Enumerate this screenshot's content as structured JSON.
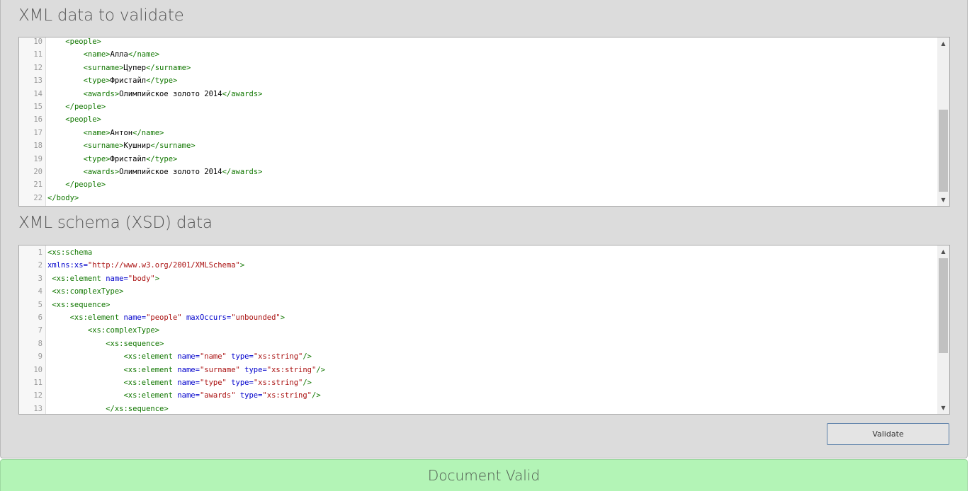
{
  "xml_section": {
    "title": "XML data to validate",
    "lines": [
      {
        "n": "10",
        "indent": "    ",
        "parts": [
          [
            "t",
            "<people>"
          ]
        ]
      },
      {
        "n": "11",
        "indent": "        ",
        "parts": [
          [
            "t",
            "<name>"
          ],
          [
            "x",
            "Алла"
          ],
          [
            "t",
            "</name>"
          ]
        ]
      },
      {
        "n": "12",
        "indent": "        ",
        "parts": [
          [
            "t",
            "<surname>"
          ],
          [
            "x",
            "Цупер"
          ],
          [
            "t",
            "</surname>"
          ]
        ]
      },
      {
        "n": "13",
        "indent": "        ",
        "parts": [
          [
            "t",
            "<type>"
          ],
          [
            "x",
            "Фристайл"
          ],
          [
            "t",
            "</type>"
          ]
        ]
      },
      {
        "n": "14",
        "indent": "        ",
        "parts": [
          [
            "t",
            "<awards>"
          ],
          [
            "x",
            "Олимпийское золото 2014"
          ],
          [
            "t",
            "</awards>"
          ]
        ]
      },
      {
        "n": "15",
        "indent": "    ",
        "parts": [
          [
            "t",
            "</people>"
          ]
        ]
      },
      {
        "n": "16",
        "indent": "    ",
        "parts": [
          [
            "t",
            "<people>"
          ]
        ]
      },
      {
        "n": "17",
        "indent": "        ",
        "parts": [
          [
            "t",
            "<name>"
          ],
          [
            "x",
            "Антон"
          ],
          [
            "t",
            "</name>"
          ]
        ]
      },
      {
        "n": "18",
        "indent": "        ",
        "parts": [
          [
            "t",
            "<surname>"
          ],
          [
            "x",
            "Кушнир"
          ],
          [
            "t",
            "</surname>"
          ]
        ]
      },
      {
        "n": "19",
        "indent": "        ",
        "parts": [
          [
            "t",
            "<type>"
          ],
          [
            "x",
            "Фристайл"
          ],
          [
            "t",
            "</type>"
          ]
        ]
      },
      {
        "n": "20",
        "indent": "        ",
        "parts": [
          [
            "t",
            "<awards>"
          ],
          [
            "x",
            "Олимпийское золото 2014"
          ],
          [
            "t",
            "</awards>"
          ]
        ]
      },
      {
        "n": "21",
        "indent": "    ",
        "parts": [
          [
            "t",
            "</people>"
          ]
        ]
      },
      {
        "n": "22",
        "indent": "",
        "parts": [
          [
            "t",
            "</body>"
          ]
        ]
      }
    ]
  },
  "xsd_section": {
    "title": "XML schema (XSD) data",
    "lines": [
      {
        "n": "1",
        "indent": "",
        "parts": [
          [
            "t",
            "<xs:schema"
          ]
        ]
      },
      {
        "n": "2",
        "indent": "",
        "parts": [
          [
            "a",
            "xmlns:xs="
          ],
          [
            "s",
            "\"http://www.w3.org/2001/XMLSchema\""
          ],
          [
            "t",
            ">"
          ]
        ]
      },
      {
        "n": "3",
        "indent": " ",
        "parts": [
          [
            "t",
            "<xs:element "
          ],
          [
            "a",
            "name="
          ],
          [
            "s",
            "\"body\""
          ],
          [
            "t",
            ">"
          ]
        ]
      },
      {
        "n": "4",
        "indent": " ",
        "parts": [
          [
            "t",
            "<xs:complexType>"
          ]
        ]
      },
      {
        "n": "5",
        "indent": " ",
        "parts": [
          [
            "t",
            "<xs:sequence>"
          ]
        ]
      },
      {
        "n": "6",
        "indent": "     ",
        "parts": [
          [
            "t",
            "<xs:element "
          ],
          [
            "a",
            "name="
          ],
          [
            "s",
            "\"people\""
          ],
          [
            "a",
            " maxOccurs="
          ],
          [
            "s",
            "\"unbounded\""
          ],
          [
            "t",
            ">"
          ]
        ]
      },
      {
        "n": "7",
        "indent": "         ",
        "parts": [
          [
            "t",
            "<xs:complexType>"
          ]
        ]
      },
      {
        "n": "8",
        "indent": "             ",
        "parts": [
          [
            "t",
            "<xs:sequence>"
          ]
        ]
      },
      {
        "n": "9",
        "indent": "                 ",
        "parts": [
          [
            "t",
            "<xs:element "
          ],
          [
            "a",
            "name="
          ],
          [
            "s",
            "\"name\""
          ],
          [
            "a",
            " type="
          ],
          [
            "s",
            "\"xs:string\""
          ],
          [
            "t",
            "/>"
          ]
        ]
      },
      {
        "n": "10",
        "indent": "                 ",
        "parts": [
          [
            "t",
            "<xs:element "
          ],
          [
            "a",
            "name="
          ],
          [
            "s",
            "\"surname\""
          ],
          [
            "a",
            " type="
          ],
          [
            "s",
            "\"xs:string\""
          ],
          [
            "t",
            "/>"
          ]
        ]
      },
      {
        "n": "11",
        "indent": "                 ",
        "parts": [
          [
            "t",
            "<xs:element "
          ],
          [
            "a",
            "name="
          ],
          [
            "s",
            "\"type\""
          ],
          [
            "a",
            " type="
          ],
          [
            "s",
            "\"xs:string\""
          ],
          [
            "t",
            "/>"
          ]
        ]
      },
      {
        "n": "12",
        "indent": "                 ",
        "parts": [
          [
            "t",
            "<xs:element "
          ],
          [
            "a",
            "name="
          ],
          [
            "s",
            "\"awards\""
          ],
          [
            "a",
            " type="
          ],
          [
            "s",
            "\"xs:string\""
          ],
          [
            "t",
            "/>"
          ]
        ]
      },
      {
        "n": "13",
        "indent": "             ",
        "parts": [
          [
            "t",
            "</xs:sequence>"
          ]
        ]
      }
    ]
  },
  "validate_button": {
    "label": "Validate"
  },
  "result": {
    "message": "Document Valid"
  },
  "colors": {
    "tag": "#117700",
    "attribute": "#0000cc",
    "string": "#aa1111",
    "result_background": "#b3f4b6"
  },
  "icons": {
    "scroll_up": "triangle-up-icon",
    "scroll_down": "triangle-down-icon"
  }
}
